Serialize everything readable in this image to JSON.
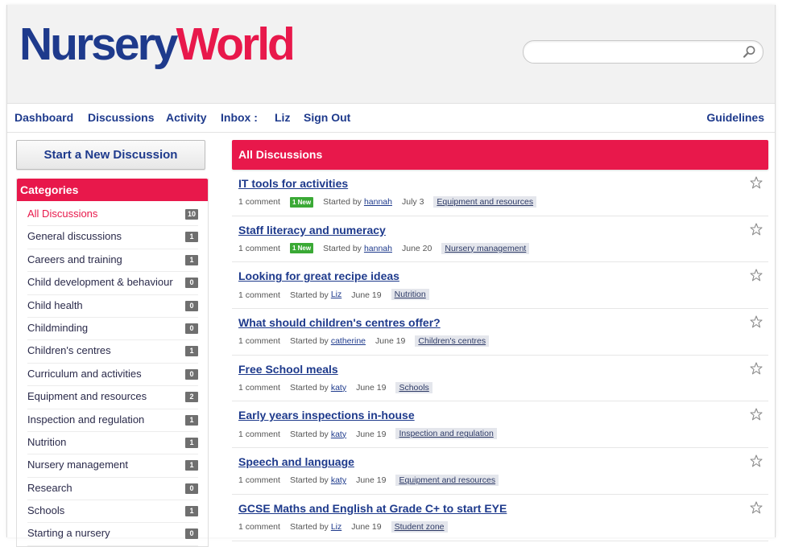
{
  "header": {
    "logo_part1": "Nursery",
    "logo_part2": "World",
    "search_placeholder": ""
  },
  "nav": {
    "items": [
      "Dashboard",
      "Discussions",
      "Activity",
      "Inbox :",
      "Liz",
      "Sign Out"
    ],
    "guidelines": "Guidelines"
  },
  "sidebar": {
    "new_discussion_label": "Start a New Discussion",
    "categories_title": "Categories",
    "categories": [
      {
        "name": "All Discussions",
        "count": "10"
      },
      {
        "name": "General discussions",
        "count": "1"
      },
      {
        "name": "Careers and training",
        "count": "1"
      },
      {
        "name": "Child development & behaviour",
        "count": "0"
      },
      {
        "name": "Child health",
        "count": "0"
      },
      {
        "name": "Childminding",
        "count": "0"
      },
      {
        "name": "Children's centres",
        "count": "1"
      },
      {
        "name": "Curriculum and activities",
        "count": "0"
      },
      {
        "name": "Equipment and resources",
        "count": "2"
      },
      {
        "name": "Inspection and regulation",
        "count": "1"
      },
      {
        "name": "Nutrition",
        "count": "1"
      },
      {
        "name": "Nursery management",
        "count": "1"
      },
      {
        "name": "Research",
        "count": "0"
      },
      {
        "name": "Schools",
        "count": "1"
      },
      {
        "name": "Starting a nursery",
        "count": "0"
      }
    ]
  },
  "main": {
    "title": "All Discussions",
    "discussions": [
      {
        "title": "IT tools for activities",
        "comments": "1 comment",
        "new_label": "1 New",
        "started_by": "Started by",
        "user": "hannah",
        "date": "July 3",
        "category": "Equipment and resources"
      },
      {
        "title": "Staff literacy and numeracy",
        "comments": "1 comment",
        "new_label": "1 New",
        "started_by": "Started by",
        "user": "hannah",
        "date": "June 20",
        "category": "Nursery management"
      },
      {
        "title": "Looking for great recipe ideas",
        "comments": "1 comment",
        "new_label": "",
        "started_by": "Started by",
        "user": "Liz",
        "date": "June 19",
        "category": "Nutrition"
      },
      {
        "title": "What should children's centres offer?",
        "comments": "1 comment",
        "new_label": "",
        "started_by": "Started by",
        "user": "catherine",
        "date": "June 19",
        "category": "Children's centres"
      },
      {
        "title": "Free School meals",
        "comments": "1 comment",
        "new_label": "",
        "started_by": "Started by",
        "user": "katy",
        "date": "June 19",
        "category": "Schools"
      },
      {
        "title": "Early years inspections in-house",
        "comments": "1 comment",
        "new_label": "",
        "started_by": "Started by",
        "user": "katy",
        "date": "June 19",
        "category": "Inspection and regulation"
      },
      {
        "title": "Speech and language",
        "comments": "1 comment",
        "new_label": "",
        "started_by": "Started by",
        "user": "katy",
        "date": "June 19",
        "category": "Equipment and resources"
      },
      {
        "title": "GCSE Maths and English at Grade C+ to start EYE",
        "comments": "1 comment",
        "new_label": "",
        "started_by": "Started by",
        "user": "Liz",
        "date": "June 19",
        "category": "Student zone"
      }
    ]
  },
  "colors": {
    "brand_blue": "#1e3a8c",
    "brand_pink": "#e8184b",
    "new_green": "#3aa935"
  }
}
